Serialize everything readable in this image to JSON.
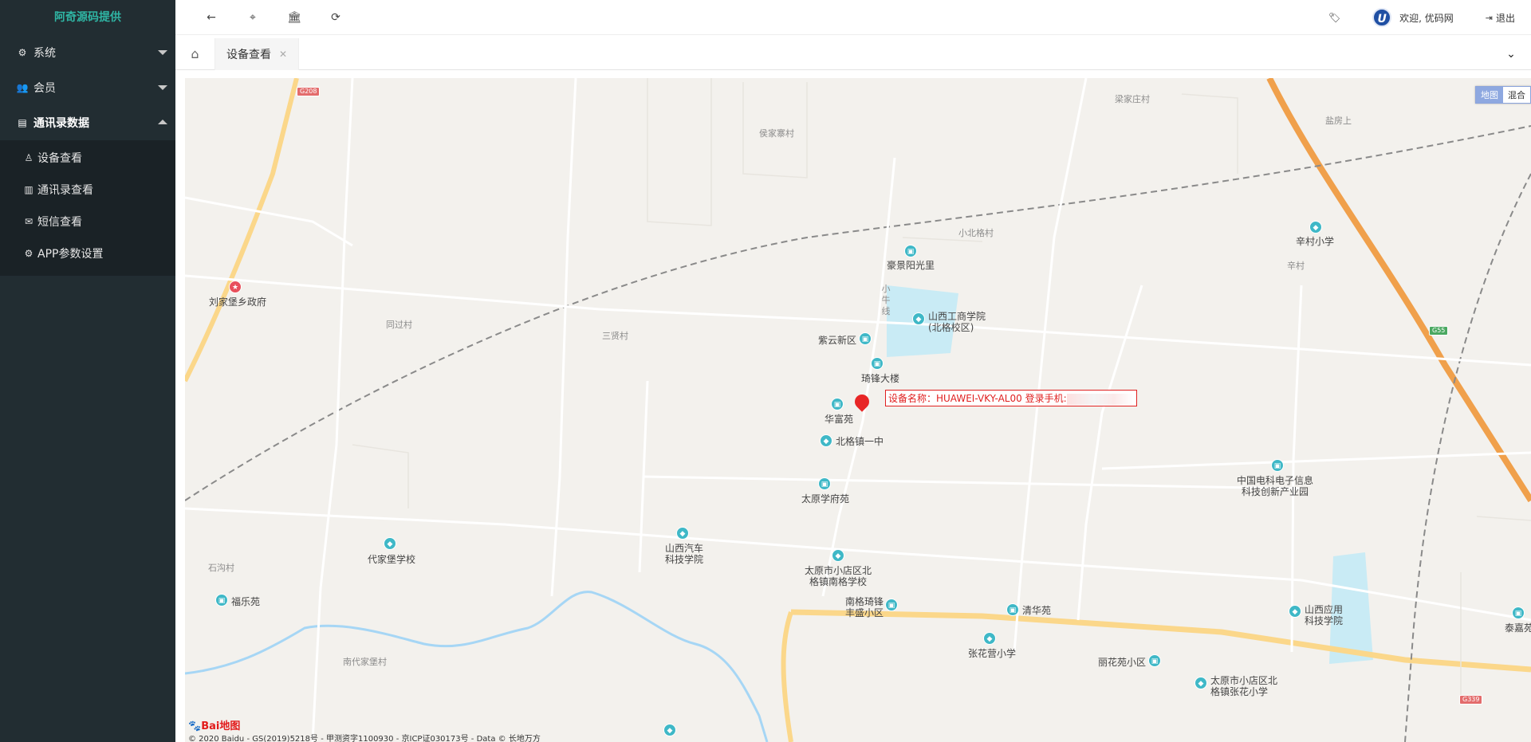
{
  "brand": "阿奇源码提供",
  "sidebar": {
    "menus": [
      {
        "icon": "gear-icon",
        "label": "系统"
      },
      {
        "icon": "users-icon",
        "label": "会员"
      },
      {
        "icon": "id-card-icon",
        "label": "通讯录数据"
      }
    ],
    "submenu": [
      {
        "icon": "user-icon",
        "label": "设备查看"
      },
      {
        "icon": "book-icon",
        "label": "通讯录查看"
      },
      {
        "icon": "envelope-icon",
        "label": "短信查看"
      },
      {
        "icon": "gear-icon",
        "label": "APP参数设置"
      }
    ]
  },
  "topbar": {
    "icons": [
      "arrow-left-icon",
      "crosshair-icon",
      "bank-icon",
      "refresh-icon"
    ],
    "welcome": "欢迎, 优码网",
    "logout": "退出"
  },
  "tabs": {
    "active": "设备查看"
  },
  "map": {
    "type_buttons": [
      "地图",
      "混合"
    ],
    "marker_label": "设备名称：HUAWEI-VKY-AL00 登录手机:",
    "places": [
      "梁家庄村",
      "盐房上",
      "侯家寨村",
      "小北格村",
      "辛村小学",
      "辛村",
      "豪景阳光里",
      "刘家堡乡政府",
      "同过村",
      "三贤村",
      "小牛线",
      "山西工商学院(北格校区)",
      "紫云新区",
      "琦锋大楼",
      "华富苑",
      "北格镇一中",
      "太原学府苑",
      "中国电科电子信息科技创新产业园",
      "代家堡学校",
      "山西汽车科技学院",
      "太原市小店区北格镇南格学校",
      "石沟村",
      "福乐苑",
      "南格琦锋丰盛小区",
      "清华苑",
      "张花营小学",
      "山西应用科技学院",
      "泰嘉苑",
      "丽花苑小区",
      "太原市小店区北格镇张花小学",
      "南代家堡村"
    ],
    "shields": [
      "G208",
      "G55",
      "G339"
    ],
    "logo_text": "Bai地图",
    "copyright": "© 2020 Baidu - GS(2019)5218号 - 甲测资字1100930 - 京ICP证030173号 - Data © 长地万方"
  }
}
